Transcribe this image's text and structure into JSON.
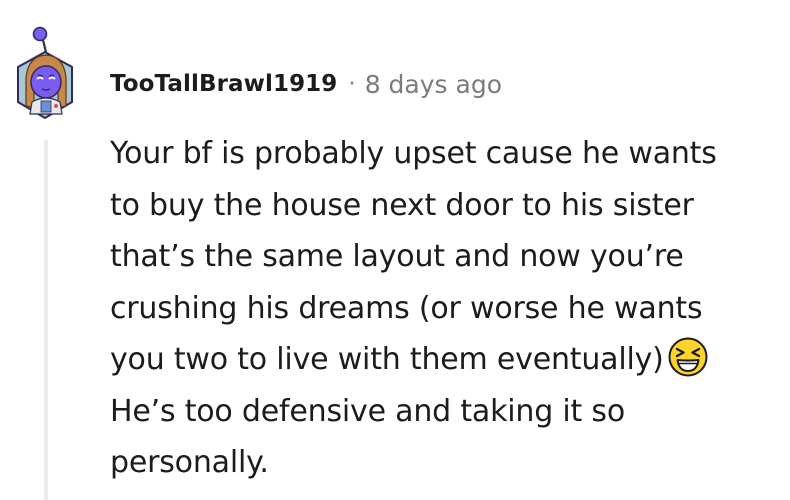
{
  "comment": {
    "username": "TooTallBrawl1919",
    "separator": "·",
    "timestamp": "8 days ago",
    "avatar_icon": "snoo-avatar-icon",
    "body_lines": [
      "Your bf is probably upset cause he wants",
      "to buy the house next door to his sister",
      "that’s the same layout and now you’re",
      "crushing his dreams (or worse he wants",
      "you two to live with them eventually)",
      "He’s too defensive and taking it so",
      "personally."
    ],
    "emoji_icon": "laughing-squinting-face-emoji"
  },
  "colors": {
    "text": "#1c1c1c",
    "meta": "#7c7c7c",
    "thread_line": "#ebebeb",
    "avatar_face": "#7b5cf0",
    "avatar_hex_bg": "#a9c7d4",
    "emoji_face": "#ffd42a"
  }
}
